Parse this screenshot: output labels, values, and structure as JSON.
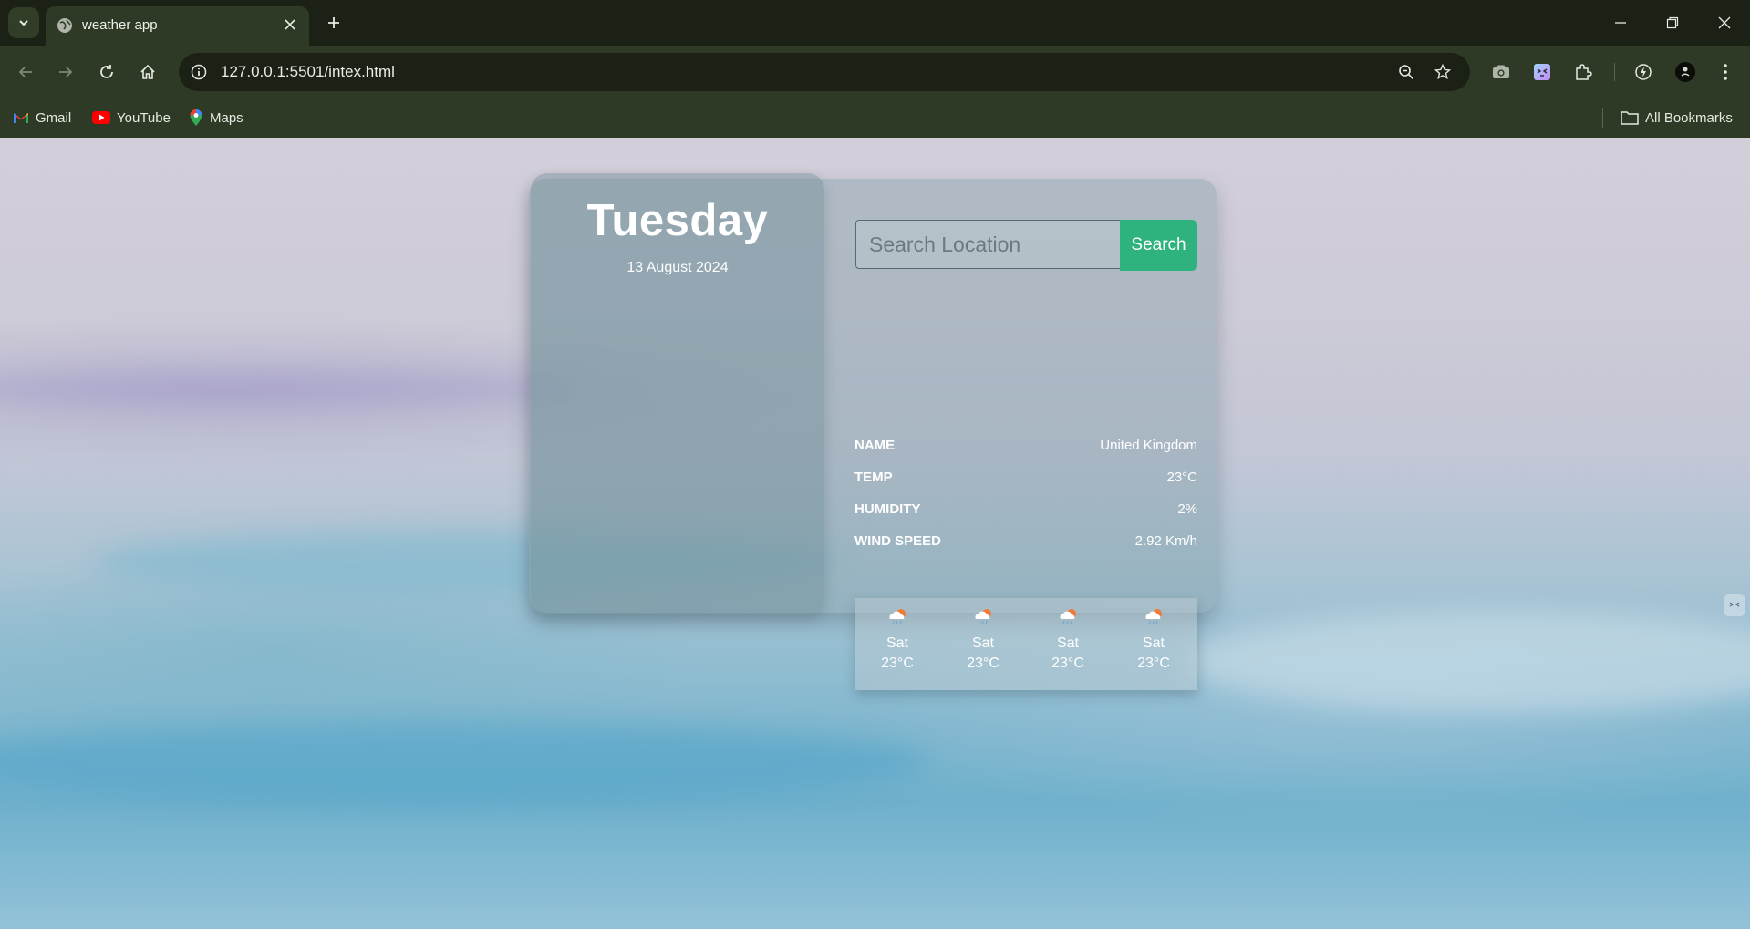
{
  "browser": {
    "tab_title": "weather app",
    "url": "127.0.0.1:5501/intex.html",
    "bookmarks": [
      {
        "label": "Gmail",
        "icon": "gmail-icon"
      },
      {
        "label": "YouTube",
        "icon": "youtube-icon"
      },
      {
        "label": "Maps",
        "icon": "maps-icon"
      }
    ],
    "all_bookmarks_label": "All Bookmarks"
  },
  "weather": {
    "day": "Tuesday",
    "date": "13 August 2024",
    "search": {
      "placeholder": "Search Location",
      "value": "",
      "button_label": "Search"
    },
    "details": [
      {
        "key": "NAME",
        "value": "United Kingdom"
      },
      {
        "key": "TEMP",
        "value": "23°C"
      },
      {
        "key": "HUMIDITY",
        "value": "2%"
      },
      {
        "key": "WIND SPEED",
        "value": "2.92 Km/h"
      }
    ],
    "forecast": [
      {
        "day": "Sat",
        "temp": "23°C",
        "icon": "rain-cloud-icon"
      },
      {
        "day": "Sat",
        "temp": "23°C",
        "icon": "rain-cloud-icon"
      },
      {
        "day": "Sat",
        "temp": "23°C",
        "icon": "rain-cloud-icon"
      },
      {
        "day": "Sat",
        "temp": "23°C",
        "icon": "rain-cloud-icon"
      }
    ]
  },
  "colors": {
    "accent": "#2fb37e",
    "chrome_dark": "#1b2115",
    "chrome": "#2f3a26"
  }
}
